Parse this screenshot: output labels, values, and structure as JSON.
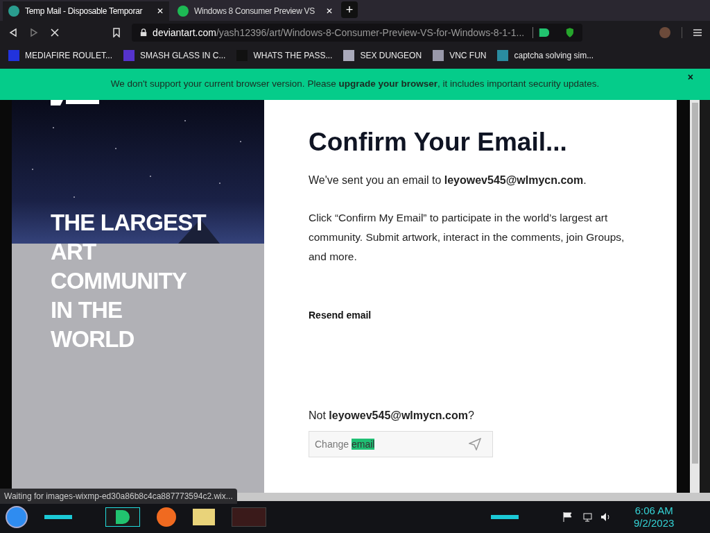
{
  "tabs": [
    {
      "title": "Temp Mail - Disposable Temporar",
      "selected": true,
      "close": "✕"
    },
    {
      "title": "Windows 8 Consumer Preview VS",
      "selected": false,
      "close": "✕"
    }
  ],
  "new_tab": "+",
  "address": {
    "domain": "deviantart.com",
    "path": "/yash12396/art/Windows-8-Consumer-Preview-VS-for-Windows-8-1-1..."
  },
  "bookmarks": [
    {
      "label": "MEDIAFIRE ROULET..."
    },
    {
      "label": "SMASH GLASS IN C..."
    },
    {
      "label": "WHATS THE PASS..."
    },
    {
      "label": "SEX DUNGEON"
    },
    {
      "label": "VNC FUN"
    },
    {
      "label": "captcha solving sim..."
    }
  ],
  "banner": {
    "text": "We don't support your current browser version. Please **upgrade your browser**, it includes important security updates.",
    "close": "×"
  },
  "left_panel": {
    "headline": [
      "THE LARGEST",
      "ART",
      "COMMUNITY",
      "IN THE",
      "WORLD"
    ]
  },
  "confirm": {
    "title": "Confirm Your Email...",
    "sent": "We've sent you an email to **leyowev545@wlmycn.com**.",
    "body": "Click “Confirm My Email” to participate in the world’s largest art community. Submit artwork, interact in the comments, join Groups, and more.",
    "resend": "Resend email",
    "not_you": "Not **leyowev545@wlmycn.com**?",
    "change_field": {
      "text": "Change ",
      "selected_text": "email"
    }
  },
  "status_text": "Waiting for images-wixmp-ed30a86b8c4ca887773594c2.wix...",
  "clock": {
    "time": "6:06 AM",
    "date": "9/2/2023"
  }
}
